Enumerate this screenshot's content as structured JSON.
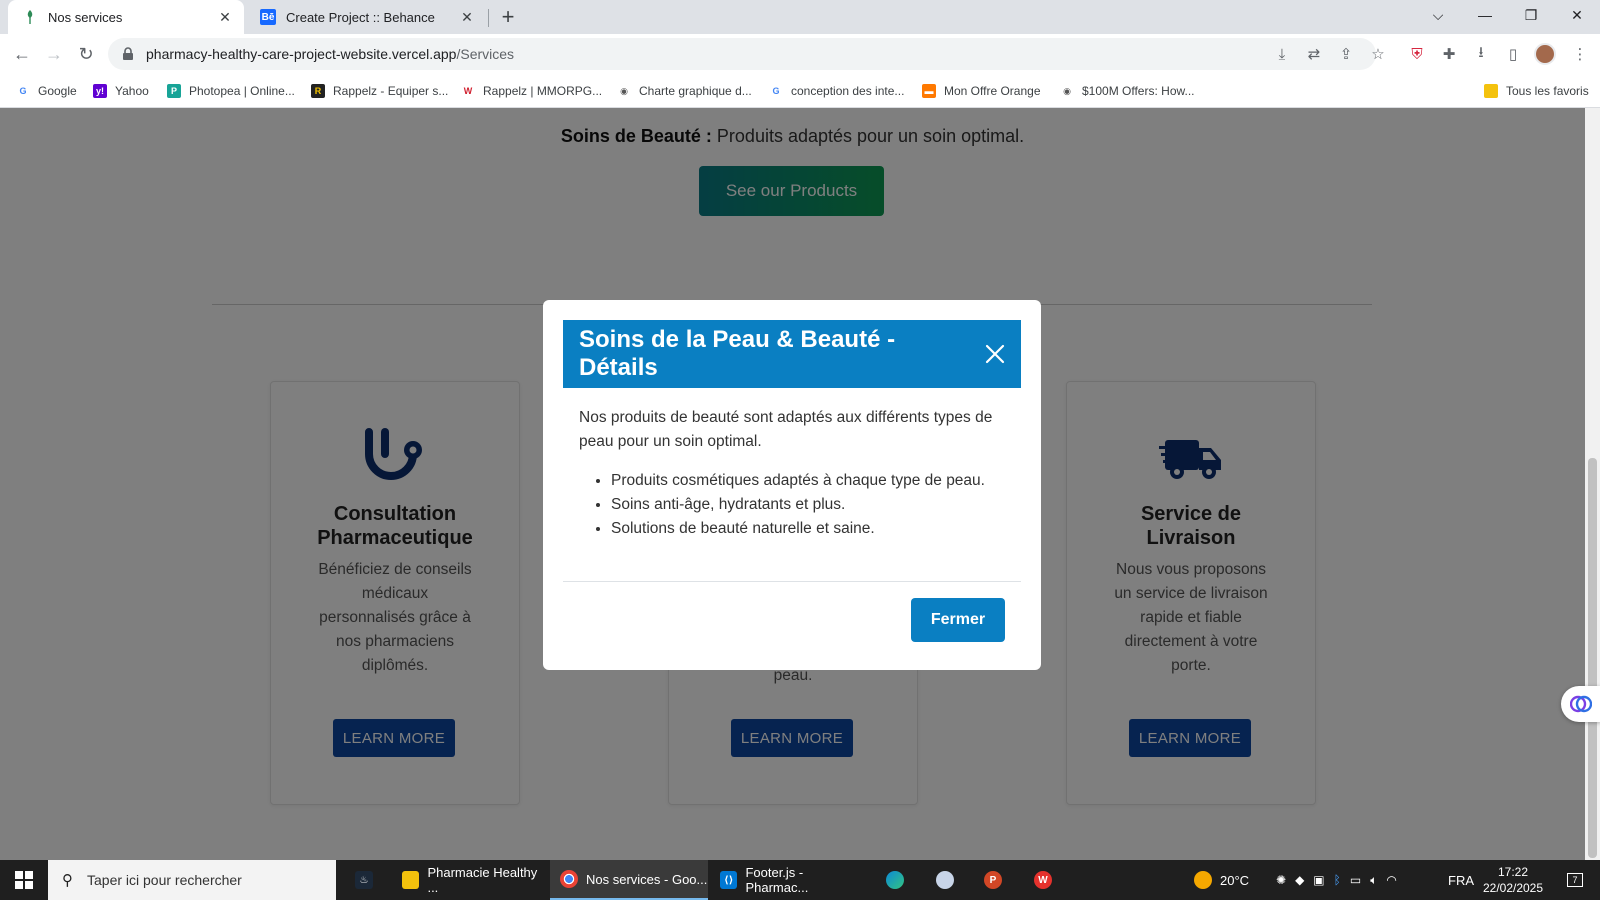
{
  "browser": {
    "tabs": [
      {
        "title": "Nos services",
        "active": true
      },
      {
        "title": "Create Project :: Behance",
        "active": false,
        "favicon": "Bē"
      }
    ],
    "url_host": "pharmacy-healthy-care-project-website.vercel.app",
    "url_path": "/Services",
    "bookmarks": [
      {
        "label": "Google"
      },
      {
        "label": "Yahoo"
      },
      {
        "label": "Photopea | Online..."
      },
      {
        "label": "Rappelz - Equiper s..."
      },
      {
        "label": "Rappelz | MMORPG..."
      },
      {
        "label": "Charte graphique d..."
      },
      {
        "label": "conception des inte..."
      },
      {
        "label": "Mon Offre Orange"
      },
      {
        "label": "$100M Offers: How..."
      }
    ],
    "all_bookmarks_label": "Tous les favoris"
  },
  "page": {
    "beauty_label": "Soins de Beauté :",
    "beauty_text": "Produits adaptés pour un soin optimal.",
    "products_button": "See our Products",
    "cards": [
      {
        "icon": "stethoscope-icon",
        "title": "Consultation Pharmaceutique",
        "text": "Bénéficiez de conseils médicaux personnalisés grâce à nos pharmaciens diplômés.",
        "button": "LEARN MORE"
      },
      {
        "text_visible": "peau.",
        "button": "LEARN MORE"
      },
      {
        "icon": "truck-icon",
        "title": "Service de Livraison",
        "text": "Nous vous proposons un service de livraison rapide et fiable directement à votre porte.",
        "button": "LEARN MORE"
      }
    ]
  },
  "modal": {
    "title": "Soins de la Peau & Beauté - Détails",
    "intro": "Nos produits de beauté sont adaptés aux différents types de peau pour un soin optimal.",
    "items": [
      "Produits cosmétiques adaptés à chaque type de peau.",
      "Soins anti-âge, hydratants et plus.",
      "Solutions de beauté naturelle et saine."
    ],
    "close_button": "Fermer"
  },
  "taskbar": {
    "search_placeholder": "Taper ici pour rechercher",
    "apps": [
      {
        "label": "Pharmacie Healthy ..."
      },
      {
        "label": "Nos services - Goo...",
        "active": true
      },
      {
        "label": "Footer.js - Pharmac..."
      }
    ],
    "temperature": "20°C",
    "language": "FRA",
    "time": "17:22",
    "date": "22/02/2025",
    "notifications": "7"
  },
  "colors": {
    "modal_header": "#0a7fc2",
    "learn_more": "#0d47a1",
    "products_gradient_start": "#0a7c86",
    "products_gradient_end": "#0c9a52",
    "icon_blue": "#0d2f6e"
  }
}
